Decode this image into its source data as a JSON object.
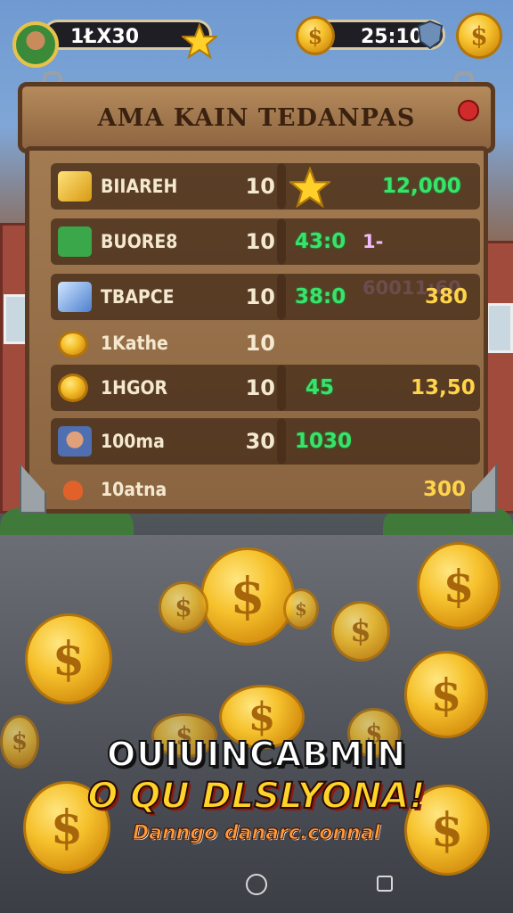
{
  "hud": {
    "left_value": "1ŁX30",
    "right_value": "25:100"
  },
  "board": {
    "title": "AMA KAIN TEDANPAS",
    "rows": [
      {
        "label": "BIIAREH",
        "qty": "10",
        "right_a": "",
        "right_b": "12,000",
        "icon": "gold-bar-icon"
      },
      {
        "label": "BUORE8",
        "qty": "10",
        "right_a": "43:0",
        "right_b": "1-60011;60",
        "icon": "cash-bag-icon"
      },
      {
        "label": "TBAPCE",
        "qty": "10",
        "right_a": "38:0",
        "right_b": "380",
        "icon": "crystal-icon"
      },
      {
        "label": "1Kathe",
        "qty": "10",
        "right_a": "",
        "right_b": "",
        "icon": "coin-icon"
      },
      {
        "label": "1HGOR",
        "qty": "10",
        "right_a": "45",
        "right_b": "13,50",
        "icon": "coin-icon"
      },
      {
        "label": "100ma",
        "qty": "30",
        "right_a": "1030",
        "right_b": "",
        "icon": "portrait-icon"
      },
      {
        "label": "10atna",
        "qty": "",
        "right_a": "",
        "right_b": "300",
        "icon": "flame-icon"
      }
    ]
  },
  "promo": {
    "line1": "OUIUINCABMIN",
    "line2": "O QU DLSLYONA!",
    "line3": "Danngo danarc.connal"
  },
  "coin_glyph": "$",
  "colors": {
    "accent_green": "#39e36a",
    "accent_yellow": "#ffd34a",
    "wood": "#8d6440"
  }
}
